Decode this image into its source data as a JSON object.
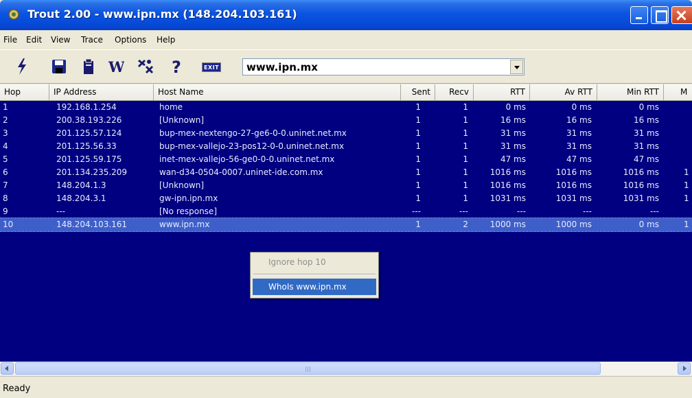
{
  "window": {
    "title": "Trout 2.00 - www.ipn.mx (148.204.103.161)",
    "icon": "trout-app-icon"
  },
  "menu": [
    "File",
    "Edit",
    "View",
    "Trace",
    "Options",
    "Help"
  ],
  "toolbar": {
    "tools": [
      "start-trace-lightning-icon",
      "save-disk-icon",
      "clipboard-icon",
      "whois-w-icon",
      "settings-icon",
      "help-question-icon"
    ],
    "exit_label": "EXIT",
    "host_value": "www.ipn.mx"
  },
  "columns": [
    "Hop",
    "IP Address",
    "Host Name",
    "Sent",
    "Recv",
    "RTT",
    "Av RTT",
    "Min RTT",
    "M"
  ],
  "rows": [
    {
      "hop": "1",
      "ip": "192.168.1.254",
      "host": "home",
      "sent": "1",
      "recv": "1",
      "rtt": "0 ms",
      "avrtt": "0 ms",
      "minrtt": "0 ms",
      "m": ""
    },
    {
      "hop": "2",
      "ip": "200.38.193.226",
      "host": "[Unknown]",
      "sent": "1",
      "recv": "1",
      "rtt": "16 ms",
      "avrtt": "16 ms",
      "minrtt": "16 ms",
      "m": ""
    },
    {
      "hop": "3",
      "ip": "201.125.57.124",
      "host": "bup-mex-nextengo-27-ge6-0-0.uninet.net.mx",
      "sent": "1",
      "recv": "1",
      "rtt": "31 ms",
      "avrtt": "31 ms",
      "minrtt": "31 ms",
      "m": ""
    },
    {
      "hop": "4",
      "ip": "201.125.56.33",
      "host": "bup-mex-vallejo-23-pos12-0-0.uninet.net.mx",
      "sent": "1",
      "recv": "1",
      "rtt": "31 ms",
      "avrtt": "31 ms",
      "minrtt": "31 ms",
      "m": ""
    },
    {
      "hop": "5",
      "ip": "201.125.59.175",
      "host": "inet-mex-vallejo-56-ge0-0-0.uninet.net.mx",
      "sent": "1",
      "recv": "1",
      "rtt": "47 ms",
      "avrtt": "47 ms",
      "minrtt": "47 ms",
      "m": ""
    },
    {
      "hop": "6",
      "ip": "201.134.235.209",
      "host": "wan-d34-0504-0007.uninet-ide.com.mx",
      "sent": "1",
      "recv": "1",
      "rtt": "1016 ms",
      "avrtt": "1016 ms",
      "minrtt": "1016 ms",
      "m": "1"
    },
    {
      "hop": "7",
      "ip": "148.204.1.3",
      "host": "[Unknown]",
      "sent": "1",
      "recv": "1",
      "rtt": "1016 ms",
      "avrtt": "1016 ms",
      "minrtt": "1016 ms",
      "m": "1"
    },
    {
      "hop": "8",
      "ip": "148.204.3.1",
      "host": "gw-ipn.ipn.mx",
      "sent": "1",
      "recv": "1",
      "rtt": "1031 ms",
      "avrtt": "1031 ms",
      "minrtt": "1031 ms",
      "m": "1"
    },
    {
      "hop": "9",
      "ip": "---",
      "host": "[No response]",
      "sent": "---",
      "recv": "---",
      "rtt": "---",
      "avrtt": "---",
      "minrtt": "---",
      "m": ""
    },
    {
      "hop": "10",
      "ip": "148.204.103.161",
      "host": "www.ipn.mx",
      "sent": "1",
      "recv": "2",
      "rtt": "1000 ms",
      "avrtt": "1000 ms",
      "minrtt": "0 ms",
      "m": "1",
      "selected": true
    }
  ],
  "context_menu": {
    "ignore_label": "Ignore hop 10",
    "whois_label": "WhoIs www.ipn.mx"
  },
  "colors": {
    "list_bg": "#000080",
    "selected_row": "#3e5fc9",
    "menu_highlight": "#316ac5"
  },
  "status": "Ready"
}
